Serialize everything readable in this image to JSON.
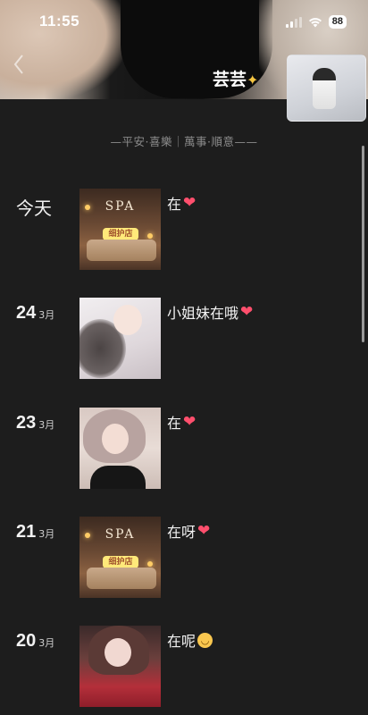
{
  "status_bar": {
    "time": "11:55",
    "battery": "88"
  },
  "profile": {
    "nickname": "芸芸",
    "signature": "—平安·喜樂｜萬事·順意——"
  },
  "posts": [
    {
      "date_label": "今天",
      "day": "",
      "month": "",
      "caption": "在",
      "emoji": "heart",
      "thumb": "spa",
      "thumb_text": "SPA",
      "thumb_badge": "细护店"
    },
    {
      "date_label": "",
      "day": "24",
      "month": "3月",
      "caption": "小姐妹在哦",
      "emoji": "heart",
      "thumb": "girl1"
    },
    {
      "date_label": "",
      "day": "23",
      "month": "3月",
      "caption": "在",
      "emoji": "heart",
      "thumb": "girl2"
    },
    {
      "date_label": "",
      "day": "21",
      "month": "3月",
      "caption": "在呀",
      "emoji": "heart",
      "thumb": "spa",
      "thumb_text": "SPA",
      "thumb_badge": "细护店"
    },
    {
      "date_label": "",
      "day": "20",
      "month": "3月",
      "caption": "在呢",
      "emoji": "smile",
      "thumb": "girl3"
    }
  ],
  "colors": {
    "background": "#1d1d1d",
    "heart": "#ff4f6d",
    "smile": "#f9c74f"
  },
  "icons": {
    "back": "chevron-left-icon",
    "signal": "signal-icon",
    "wifi": "wifi-icon",
    "heart": "heart-icon",
    "smile": "smile-icon"
  }
}
